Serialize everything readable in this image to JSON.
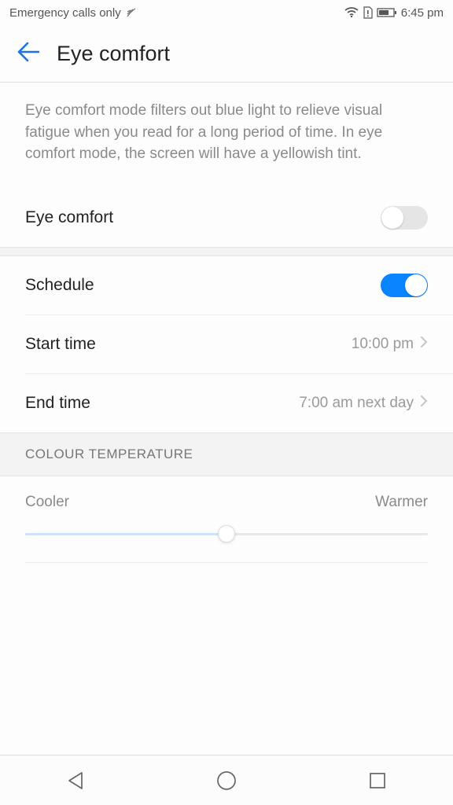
{
  "statusbar": {
    "left_text": "Emergency calls only",
    "time": "6:45 pm"
  },
  "header": {
    "title": "Eye comfort"
  },
  "description": "Eye comfort mode filters out blue light to relieve visual fatigue when you read for a long period of time. In eye comfort mode, the screen will have a yellowish tint.",
  "rows": {
    "eye_comfort": {
      "label": "Eye comfort",
      "on": false
    },
    "schedule": {
      "label": "Schedule",
      "on": true
    },
    "start_time": {
      "label": "Start time",
      "value": "10:00 pm"
    },
    "end_time": {
      "label": "End time",
      "value": "7:00 am next day"
    }
  },
  "section": {
    "temperature_header": "COLOUR TEMPERATURE",
    "cooler": "Cooler",
    "warmer": "Warmer",
    "slider_percent": 50
  }
}
